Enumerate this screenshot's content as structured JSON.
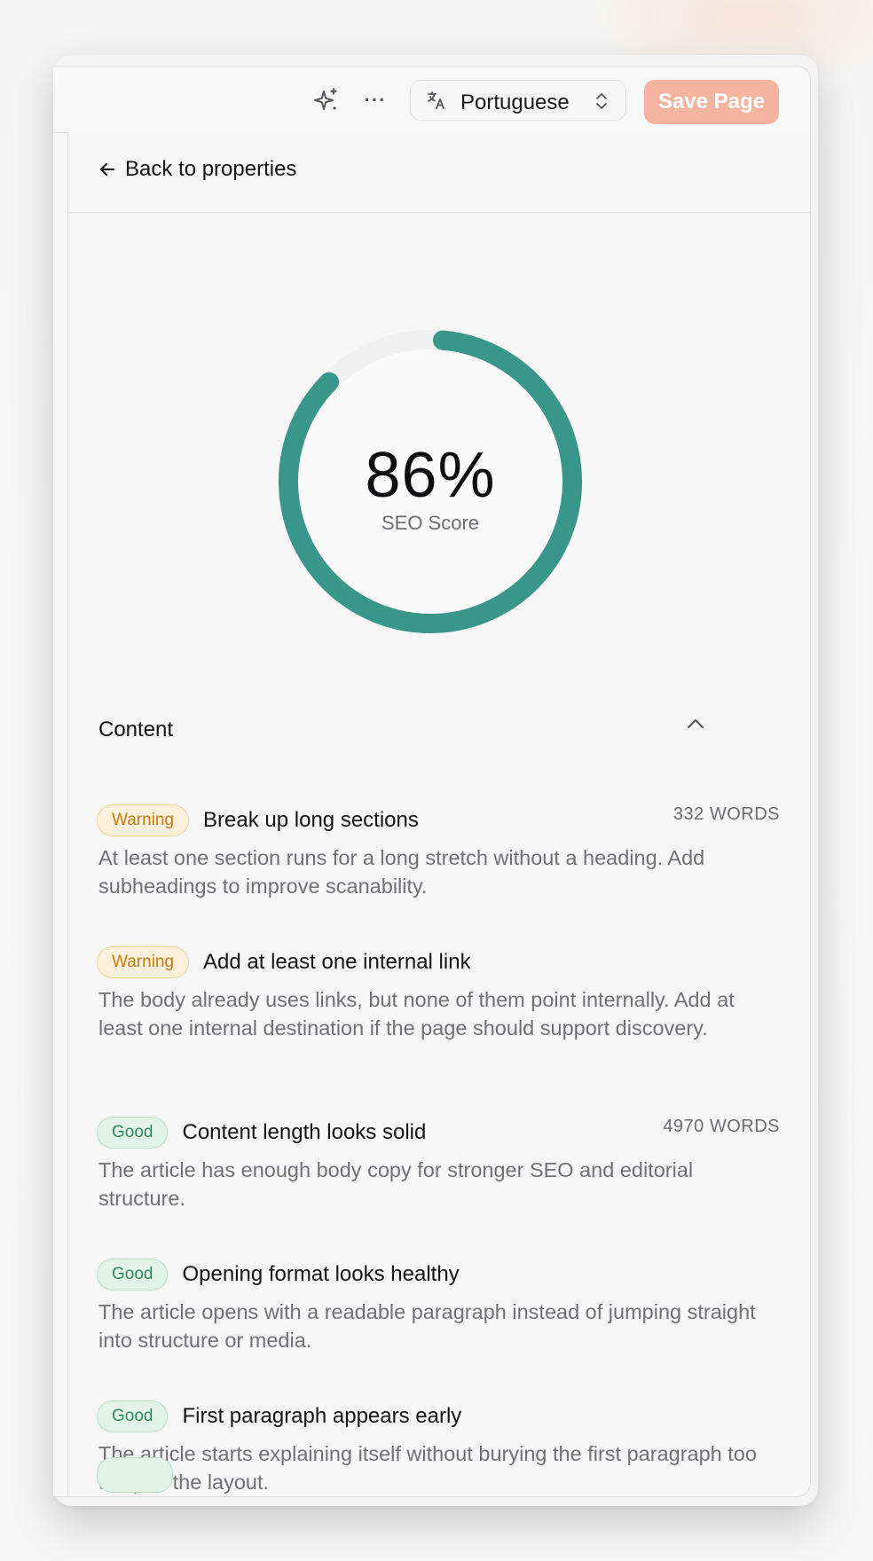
{
  "header": {
    "sparkle_icon": "sparkle-icon",
    "more_label": "···",
    "language": "Portuguese",
    "save_label": "Save Page",
    "save_color": "#f4b4a0"
  },
  "back": {
    "label": "Back to properties"
  },
  "score": {
    "value_text": "86%",
    "value": 86,
    "label": "SEO Score",
    "color": "#39968a",
    "track_color": "#f0f0f1"
  },
  "section": {
    "title": "Content"
  },
  "checks": [
    {
      "status": "Warning",
      "title": "Break up long sections",
      "count": "332 WORDS",
      "description": "At least one section runs for a long stretch without a heading. Add subheadings to improve scanability."
    },
    {
      "status": "Warning",
      "title": "Add at least one internal link",
      "count": "",
      "description": "The body already uses links, but none of them point internally. Add at least one internal destination if the page should support discovery."
    },
    {
      "status": "Good",
      "title": "Content length looks solid",
      "count": "4970 WORDS",
      "description": "The article has enough body copy for stronger SEO and editorial structure."
    },
    {
      "status": "Good",
      "title": "Opening format looks healthy",
      "count": "",
      "description": "The article opens with a readable paragraph instead of jumping straight into structure or media."
    },
    {
      "status": "Good",
      "title": "First paragraph appears early",
      "count": "",
      "description": "The article starts explaining itself without burying the first paragraph too deep in the layout."
    }
  ]
}
